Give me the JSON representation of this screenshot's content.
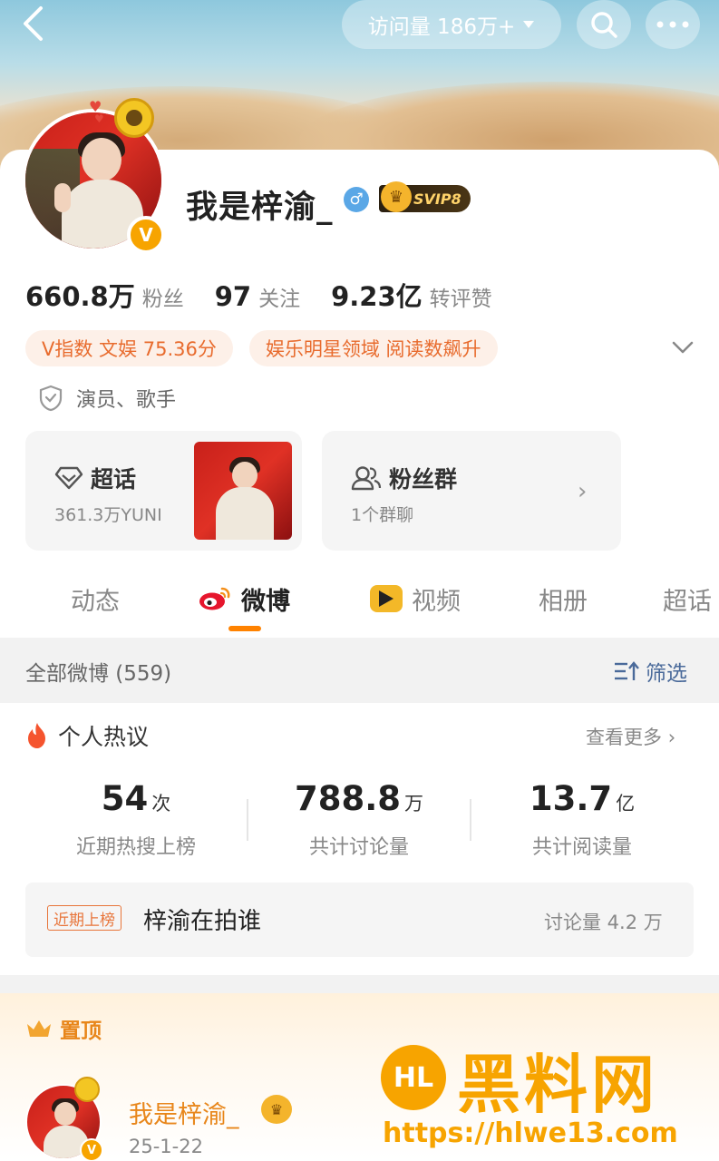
{
  "header": {
    "back_icon": "chevron-left-icon",
    "visits_label": "访问量 186万+",
    "search_icon": "search-icon",
    "more_icon": "more-dots-icon"
  },
  "profile": {
    "name": "我是梓渝_",
    "gender": "♂",
    "svip_label": "SVIP8",
    "verified_badge": "V",
    "stats": [
      {
        "value": "660.8万",
        "label": "粉丝"
      },
      {
        "value": "97",
        "label": "关注"
      },
      {
        "value": "9.23亿",
        "label": "转评赞"
      }
    ],
    "tags": [
      "V指数 文娱 75.36分",
      "娱乐明星领域 阅读数飙升"
    ],
    "certification": "演员、歌手"
  },
  "quick_cards": {
    "supertopic": {
      "title": "超话",
      "subtitle": "361.3万YUNI"
    },
    "fans_group": {
      "title": "粉丝群",
      "subtitle": "1个群聊"
    }
  },
  "tabs": [
    {
      "label": "动态",
      "active": false
    },
    {
      "label": "微博",
      "active": true
    },
    {
      "label": "视频",
      "active": false
    },
    {
      "label": "相册",
      "active": false
    },
    {
      "label": "超话",
      "active": false
    }
  ],
  "filter_bar": {
    "all_label": "全部微博 (559)",
    "filter_label": "筛选"
  },
  "hot": {
    "title": "个人热议",
    "more_label": "查看更多",
    "stats": [
      {
        "num": "54",
        "unit": "次",
        "label": "近期热搜上榜"
      },
      {
        "num": "788.8",
        "unit": "万",
        "label": "共计讨论量"
      },
      {
        "num": "13.7",
        "unit": "亿",
        "label": "共计阅读量"
      }
    ],
    "row": {
      "badge": "近期上榜",
      "topic": "梓渝在拍谁",
      "count": "讨论量 4.2 万"
    }
  },
  "pinned": {
    "label": "置顶",
    "author": "我是梓渝_",
    "date": "25-1-22"
  },
  "watermark": {
    "logo": "HL",
    "title": "黑料网",
    "url": "https://hlwe13.com"
  },
  "colors": {
    "accent": "#ff8200",
    "tag_bg": "#fdf0e8",
    "tag_text": "#e86b2d",
    "link": "#4a6a9a",
    "watermark": "#f7a400"
  }
}
